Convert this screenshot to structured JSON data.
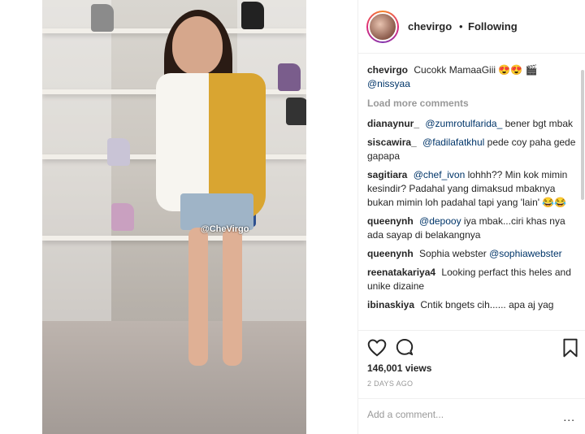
{
  "post": {
    "video_watermark": "@CheVirgo"
  },
  "header": {
    "username": "chevirgo",
    "separator": "•",
    "follow_status": "Following"
  },
  "caption": {
    "username": "chevirgo",
    "text": "Cucokk MamaaGiii 😍😍 🎬",
    "mention": "@nissyaa"
  },
  "load_more": "Load more comments",
  "comments": [
    {
      "username": "dianaynur_",
      "mention": "@zumrotulfarida_",
      "text": "bener bgt mbak"
    },
    {
      "username": "siscawira_",
      "mention": "@fadilafatkhul",
      "text": "pede coy paha gede gapapa"
    },
    {
      "username": "sagitiara",
      "mention": "@chef_ivon",
      "text": "lohhh?? Min kok mimin kesindir? Padahal yang dimaksud mbaknya bukan mimin loh padahal tapi yang 'lain' 😂😂"
    },
    {
      "username": "queenynh",
      "mention": "@depooy",
      "text": "iya mbak...ciri khas nya ada sayap di belakangnya"
    },
    {
      "username": "queenynh",
      "mention": "@sophiawebster",
      "text": "Sophia webster",
      "mention_after": true
    },
    {
      "username": "reenatakariya4",
      "mention": "",
      "text": "Looking perfact this heles and unike dizaine"
    },
    {
      "username": "ibinaskiya",
      "mention": "",
      "text": "Cntik bngets cih...... apa aj yag"
    }
  ],
  "icons": {
    "like": "heart-icon",
    "comment": "comment-icon",
    "save": "bookmark-icon"
  },
  "likes": "146,001 views",
  "timestamp": "2 DAYS AGO",
  "add_comment": {
    "placeholder": "Add a comment...",
    "more": "..."
  }
}
